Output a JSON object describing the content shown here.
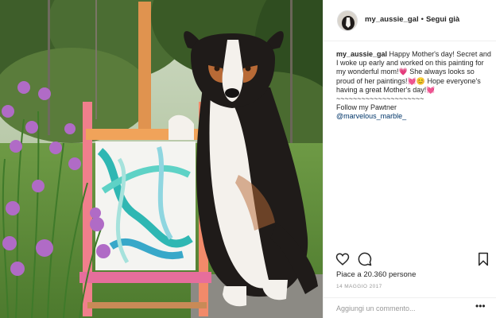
{
  "post": {
    "header": {
      "username": "my_aussie_gal",
      "separator": "•",
      "follow_label": "Segui già"
    },
    "caption": {
      "username": "my_aussie_gal",
      "text": " Happy Mother's day! Secret and I woke up early and worked on this painting for my wonderful mom!💗 She always looks so proud of her paintings!💓😊 Hope everyone's having a great Mother's day!💓\n~~~~~~~~~~~~~~~~~~~~~\nFollow my Pawtner\n",
      "mention": "@marvelous_marble_"
    },
    "actions": {
      "like_icon": "heart-icon",
      "comment_icon": "comment-bubble-icon",
      "save_icon": "bookmark-icon"
    },
    "likes_text": "Piace a 20.360 persone",
    "date": "14 MAGGIO 2017",
    "comment": {
      "placeholder": "Aggiungi un commento...",
      "more_icon": "more-options-icon",
      "more_glyph": "•••"
    },
    "colors": {
      "text": "#262626",
      "muted": "#999999",
      "link": "#003569",
      "border": "#efefef"
    }
  }
}
